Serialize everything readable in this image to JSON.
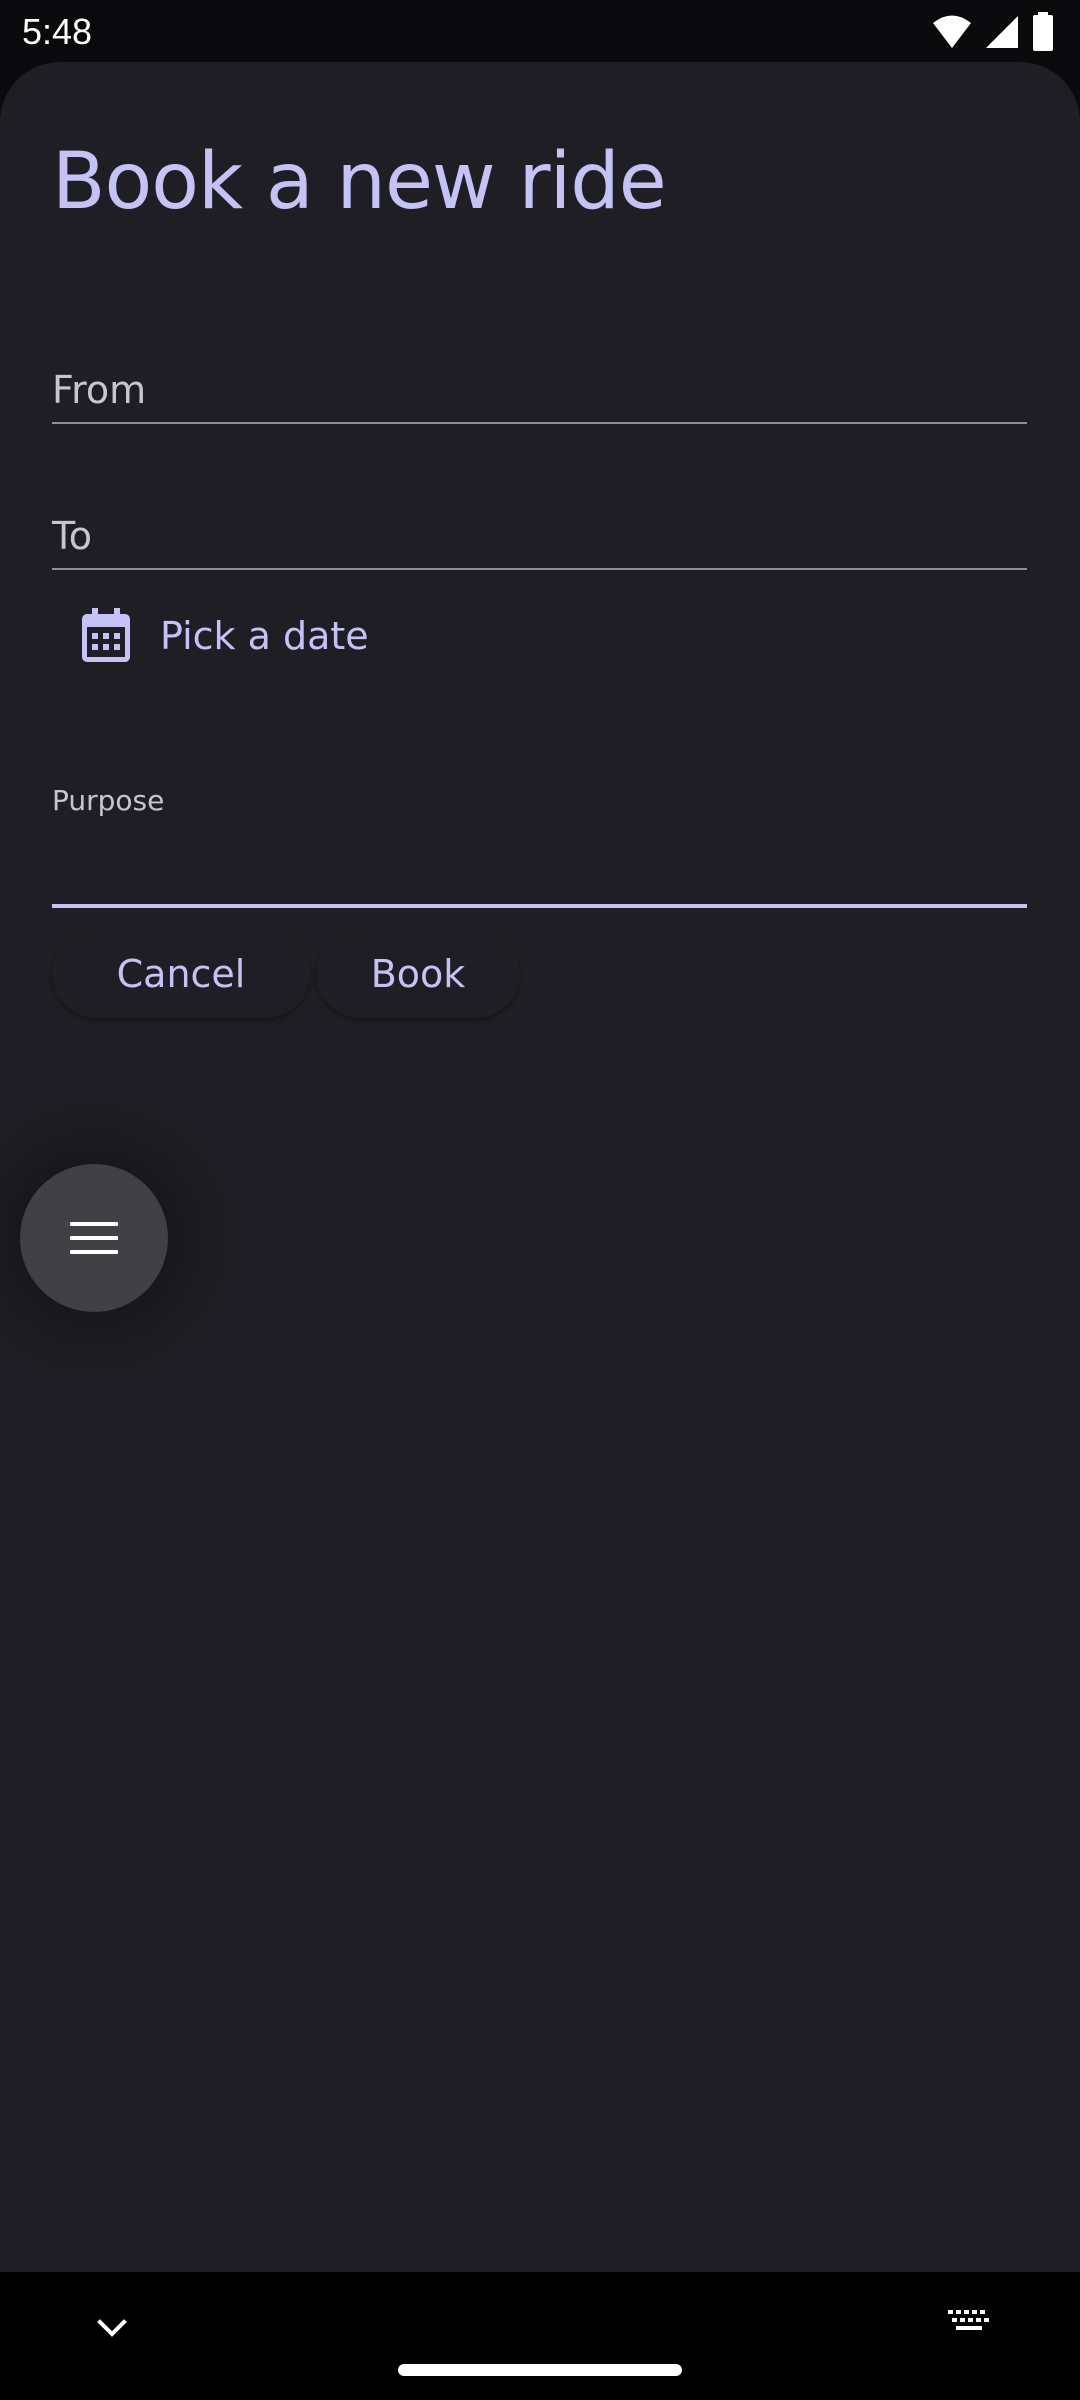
{
  "status_bar": {
    "time": "5:48",
    "icons": [
      "wifi-icon",
      "signal-icon",
      "battery-icon"
    ]
  },
  "form": {
    "title": "Book a new ride",
    "from_label": "From",
    "to_label": "To",
    "date_button_label": "Pick a date",
    "purpose_label": "Purpose",
    "purpose_value": "",
    "cancel_label": "Cancel",
    "book_label": "Book"
  },
  "fab": {
    "icon": "menu-icon"
  },
  "nav_bar": {
    "icons": [
      "chevron-down-icon",
      "home-handle",
      "keyboard-icon"
    ]
  },
  "colors": {
    "background": "#1e1e24",
    "accent": "#c5c2f5",
    "fab": "#404045"
  }
}
